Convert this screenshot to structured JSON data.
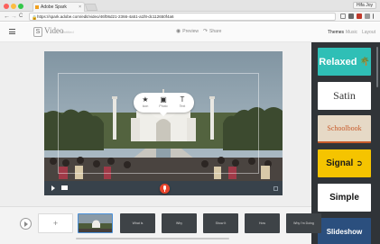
{
  "browser": {
    "tab_title": "Adobe Spark",
    "tab_close": "×",
    "user_badge": "Hifa Joy",
    "nav_back": "←",
    "nav_forward": "→",
    "nav_reload": "C",
    "lock_symbol": "🔒",
    "url": "https://spark.adobe.com/edit/video/46f06d21-2366-4a51-a1f8-dc112650f4a6"
  },
  "app": {
    "logo_glyph": "S",
    "title": "Video",
    "subtitle": "Untitled",
    "preview_label": "Preview",
    "share_label": "Share",
    "preview_icon": "eye-icon",
    "share_icon": "share-icon"
  },
  "panel_tabs": [
    {
      "label": "Themes",
      "active": true
    },
    {
      "label": "Music",
      "active": false
    },
    {
      "label": "Layout",
      "active": false
    }
  ],
  "popup": {
    "items": [
      {
        "icon": "★",
        "label": "Icon"
      },
      {
        "icon": "▣",
        "label": "Photo"
      },
      {
        "icon": "T",
        "label": "Text"
      }
    ]
  },
  "themes": [
    {
      "label": "Relaxed",
      "bg": "#2fbfb6",
      "color": "#ffffff",
      "icon": "palm-tree-icon"
    },
    {
      "label": "Satin",
      "bg": "#ffffff",
      "color": "#3a3a3a"
    },
    {
      "label": "Schoolbook",
      "bg": "#e6d9c6",
      "color": "#c75a2a"
    },
    {
      "label": "Signal",
      "bg": "#f5c400",
      "color": "#1a1a1a",
      "icon": "circle-arrow-icon"
    },
    {
      "label": "Simple",
      "bg": "#ffffff",
      "color": "#111111"
    },
    {
      "label": "Slideshow",
      "bg": "#2b4f7e",
      "color": "#ffffff"
    }
  ],
  "timeline": {
    "add_glyph": "+",
    "slides": [
      {
        "kind": "add"
      },
      {
        "kind": "photo"
      },
      {
        "kind": "text",
        "label": "What Is"
      },
      {
        "kind": "text",
        "label": "Why"
      },
      {
        "kind": "text",
        "label": "Show It"
      },
      {
        "kind": "text",
        "label": "How"
      },
      {
        "kind": "text",
        "label": "Why I'm Doing"
      }
    ]
  },
  "colors": {
    "accent_red": "#e8452c",
    "panel_dark": "#303438",
    "selected_outline": "#4a90d9"
  }
}
